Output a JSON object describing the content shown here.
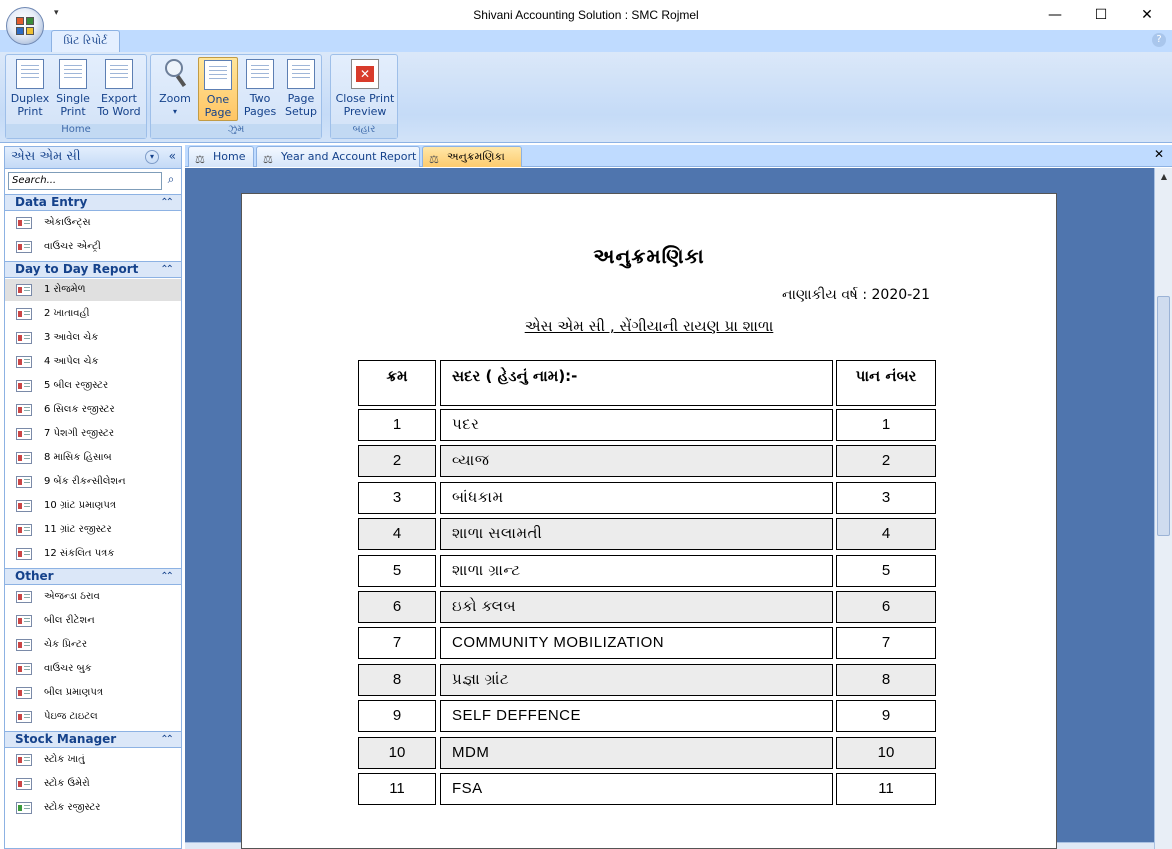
{
  "window": {
    "title": "Shivani Accounting Solution : SMC Rojmel",
    "minimize": "—",
    "maximize": "☐",
    "close": "✕",
    "qat": "▾"
  },
  "ribbon": {
    "tab": "પ્રિંટ રિપોર્ટ",
    "help": "?",
    "groups": [
      {
        "label": "Home",
        "buttons": [
          {
            "l1": "Duplex",
            "l2": "Print"
          },
          {
            "l1": "Single",
            "l2": "Print"
          },
          {
            "l1": "Export",
            "l2": "To Word"
          }
        ]
      },
      {
        "label": "ઝુમ",
        "buttons": [
          {
            "l1": "Zoom",
            "l2": "▾"
          },
          {
            "l1": "One",
            "l2": "Page"
          },
          {
            "l1": "Two",
            "l2": "Pages"
          },
          {
            "l1": "Page",
            "l2": "Setup"
          }
        ]
      },
      {
        "label": "બહાર",
        "buttons": [
          {
            "l1": "Close Print",
            "l2": "Preview"
          }
        ]
      }
    ]
  },
  "nav": {
    "title": "એસ એમ સી",
    "collapse": "«",
    "dropdown": "▾",
    "search_placeholder": "Search...",
    "sections": [
      {
        "title": "Data Entry",
        "items": [
          "એકાઉન્ટ્સ",
          "વાઉચર એન્ટ્રી"
        ]
      },
      {
        "title": "Day to Day Report",
        "items": [
          "1 રોજમેળ",
          "2 ખાતાવહી",
          "3 આવેલ ચેક",
          "4 આપેલ ચેક",
          "5 બીલ રજીસ્ટર",
          "6 સિલક રજીસ્ટર",
          "7 પેશગી રજીસ્ટર",
          "8 માસિક હિસાબ",
          "9 બેંક રીકન્સીલેશન",
          "10 ગ્રાંટ પ્રમાણપત્ર",
          "11 ગ્રાંટ રજીસ્ટર",
          "12 સંકલિત પત્રક"
        ]
      },
      {
        "title": "Other",
        "items": [
          "એજન્ડા ઠરાવ",
          "બીલ રીટેશન",
          "ચેક પ્રિન્ટર",
          "વાઉચર બુક",
          "બીલ પ્રમાણપત્ર",
          "પેઇજ ટાઇટલ"
        ]
      },
      {
        "title": "Stock Manager",
        "items": [
          "સ્ટોક ખાતું",
          "સ્ટોક ઉમેરો",
          "સ્ટોક રજીસ્ટર"
        ]
      }
    ]
  },
  "tabs": [
    "Home",
    "Year and Account Report",
    "અનુક્રમણિકા"
  ],
  "report": {
    "title": "અનુક્રમણિકા",
    "fy_label": "નાણાકીય વર્ષ : 2020-21",
    "school": "એસ એમ સી , સેંગીયાની રાયણ પ્રા શાળા",
    "headers": [
      "ક્રમ",
      "સદર ( હેડનું નામ):-",
      "પાન નંબર"
    ],
    "rows": [
      [
        "1",
        "પદર",
        "1"
      ],
      [
        "2",
        "વ્યાજ",
        "2"
      ],
      [
        "3",
        "બાંધકામ",
        "3"
      ],
      [
        "4",
        "શાળા સલામતી",
        "4"
      ],
      [
        "5",
        "શાળા ગ્રાન્ટ",
        "5"
      ],
      [
        "6",
        "ઇકો ક્લબ",
        "6"
      ],
      [
        "7",
        "COMMUNITY MOBILIZATION",
        "7"
      ],
      [
        "8",
        "પ્રજ્ઞા ગ્રાંટ",
        "8"
      ],
      [
        "9",
        "SELF DEFFENCE",
        "9"
      ],
      [
        "10",
        "MDM",
        "10"
      ],
      [
        "11",
        "FSA",
        "11"
      ]
    ]
  }
}
